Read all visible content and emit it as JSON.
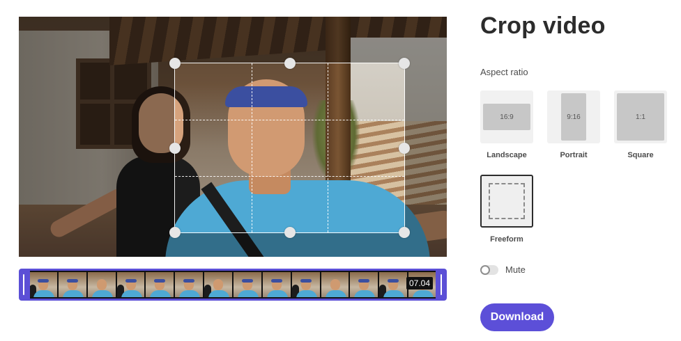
{
  "panel": {
    "title": "Crop video",
    "aspect_ratio_label": "Aspect ratio",
    "ratios": [
      {
        "name": "Landscape",
        "shape_label": "16:9"
      },
      {
        "name": "Portrait",
        "shape_label": "9:16"
      },
      {
        "name": "Square",
        "shape_label": "1:1"
      },
      {
        "name": "Freeform",
        "shape_label": ""
      }
    ],
    "selected_ratio": "Freeform",
    "mute_label": "Mute",
    "mute_on": false,
    "download_label": "Download"
  },
  "timeline": {
    "duration": "07.04"
  },
  "colors": {
    "accent": "#5c4fd8",
    "title": "#2c2c2c",
    "tile_bg": "#f1f1f1"
  }
}
